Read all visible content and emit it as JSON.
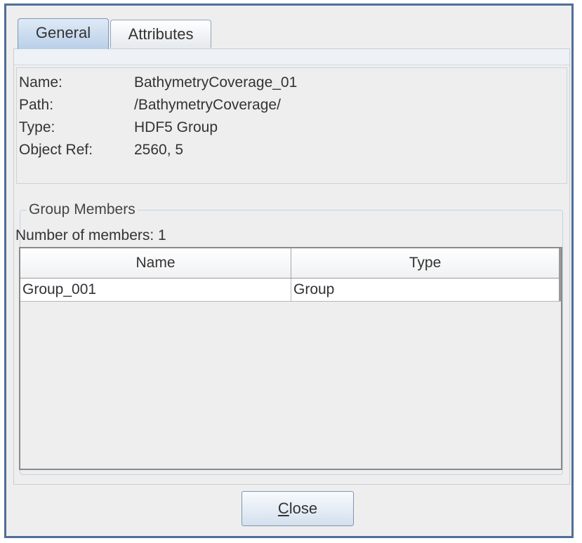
{
  "tabs": [
    {
      "label": "General",
      "active": true
    },
    {
      "label": "Attributes",
      "active": false
    }
  ],
  "info": {
    "name_label": "Name:",
    "name_value": "BathymetryCoverage_01",
    "path_label": "Path:",
    "path_value": "/BathymetryCoverage/",
    "type_label": "Type:",
    "type_value": "HDF5 Group",
    "objref_label": "Object Ref:",
    "objref_value": "2560, 5"
  },
  "group_members": {
    "legend": "Group Members",
    "count_text": "Number of members: 1",
    "columns": [
      "Name",
      "Type"
    ],
    "rows": [
      {
        "name": "Group_001",
        "type": "Group"
      }
    ]
  },
  "buttons": {
    "close_mnemonic": "C",
    "close_rest": "lose"
  },
  "colors": {
    "frame_border": "#4f6f98",
    "active_tab": "#b9cfe8",
    "background": "#eeeeee"
  }
}
